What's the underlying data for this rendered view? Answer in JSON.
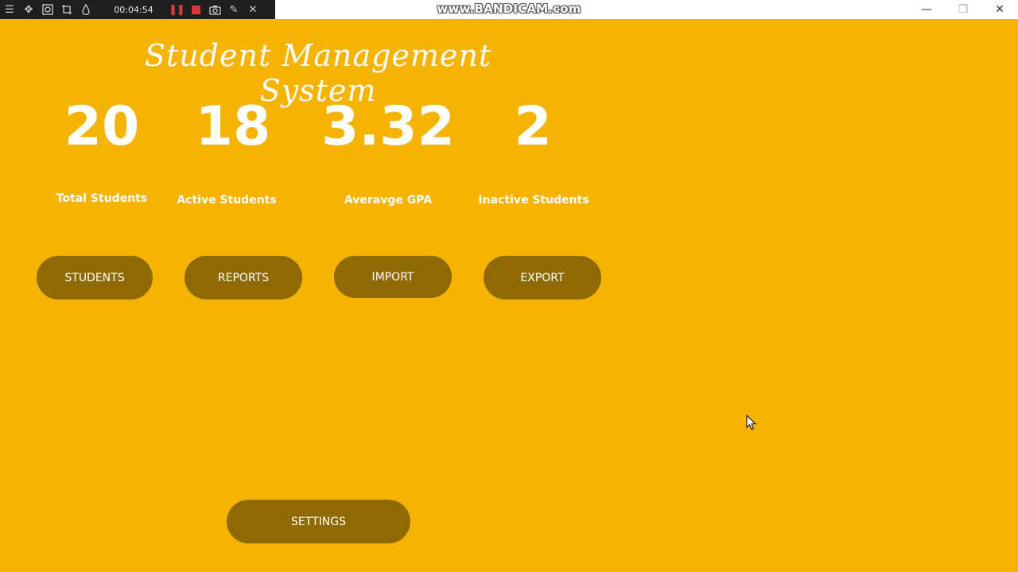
{
  "recorder": {
    "elapsed": "00:04:54",
    "icons": [
      "menu-icon",
      "resize-icon",
      "zoom-region-icon",
      "crop-icon",
      "drop-icon",
      "pause-icon",
      "stop-icon",
      "camera-icon",
      "pen-icon",
      "close-icon"
    ]
  },
  "watermark": "www.BANDICAM.com",
  "window_controls": [
    "minimize",
    "restore",
    "close"
  ],
  "app": {
    "title": "Student Management System"
  },
  "stats": [
    {
      "value": "20",
      "label": "Total Students"
    },
    {
      "value": "18",
      "label": "Active Students"
    },
    {
      "value": "3.32",
      "label": "Averavge GPA"
    },
    {
      "value": "2",
      "label": "Inactive Students"
    }
  ],
  "buttons": {
    "students": "STUDENTS",
    "reports": "REPORTS",
    "import": "IMPORT",
    "export": "EXPORT",
    "settings": "SETTINGS"
  },
  "colors": {
    "background": "#f5b304",
    "button": "#8f6a03",
    "text": "#ffffff"
  }
}
